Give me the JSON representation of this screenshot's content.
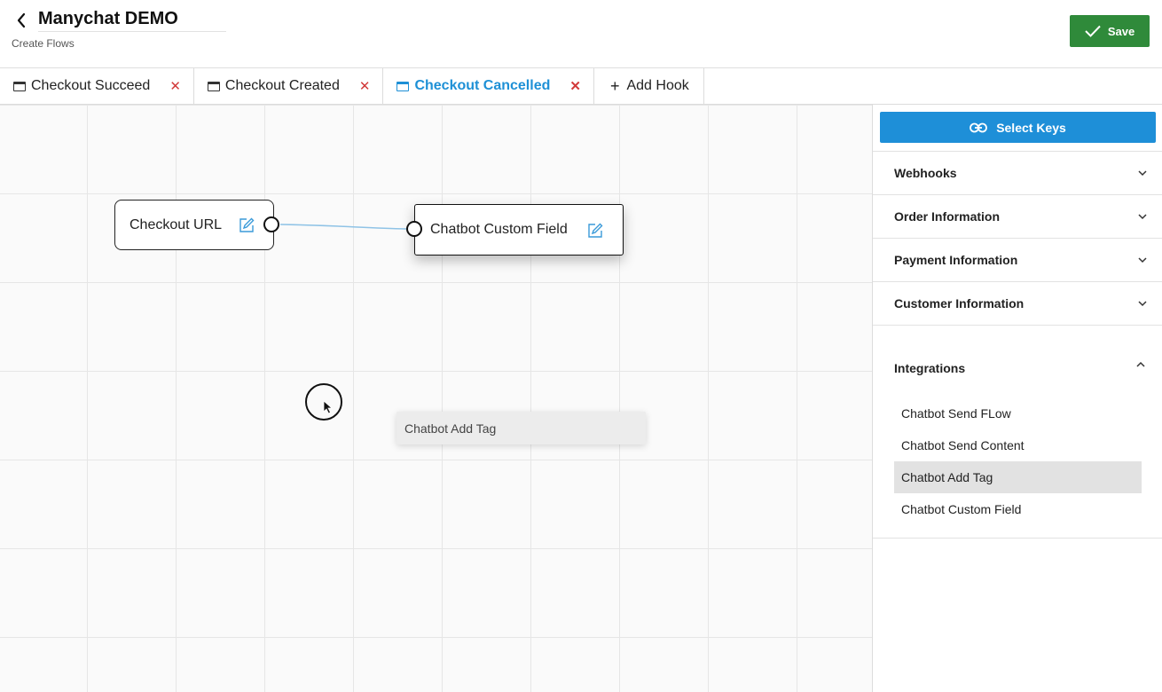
{
  "header": {
    "title": "Manychat DEMO",
    "subtitle": "Create Flows",
    "save_label": "Save"
  },
  "tabs": [
    {
      "label": "Checkout Succeed",
      "active": false
    },
    {
      "label": "Checkout Created",
      "active": false
    },
    {
      "label": "Checkout Cancelled",
      "active": true
    },
    {
      "label": "Add Hook",
      "active": false
    }
  ],
  "canvas": {
    "nodes": [
      {
        "label": "Checkout URL"
      },
      {
        "label": "Chatbot Custom Field"
      }
    ],
    "drag_ghost_label": "Chatbot Add Tag"
  },
  "sidebar": {
    "select_keys_label": "Select Keys",
    "sections": [
      {
        "label": "Webhooks",
        "expanded": false
      },
      {
        "label": "Order Information",
        "expanded": false
      },
      {
        "label": "Payment Information",
        "expanded": false
      },
      {
        "label": "Customer Information",
        "expanded": false
      }
    ],
    "integrations": {
      "label": "Integrations",
      "expanded": true,
      "items": [
        {
          "label": "Chatbot Send FLow",
          "selected": false
        },
        {
          "label": "Chatbot Send Content",
          "selected": false
        },
        {
          "label": "Chatbot Add Tag",
          "selected": true
        },
        {
          "label": "Chatbot Custom Field",
          "selected": false
        }
      ]
    }
  },
  "colors": {
    "save_green": "#2f8a3a",
    "accent_blue": "#1e8fd8",
    "close_red": "#d23a3a",
    "connector": "#8fc3e6"
  },
  "icons": [
    "chevron-left-icon",
    "check-icon",
    "window-icon",
    "close-icon",
    "plus-icon",
    "edit-icon",
    "link-icon",
    "chevron-down-icon",
    "chevron-up-icon",
    "cursor-arrow-icon"
  ]
}
